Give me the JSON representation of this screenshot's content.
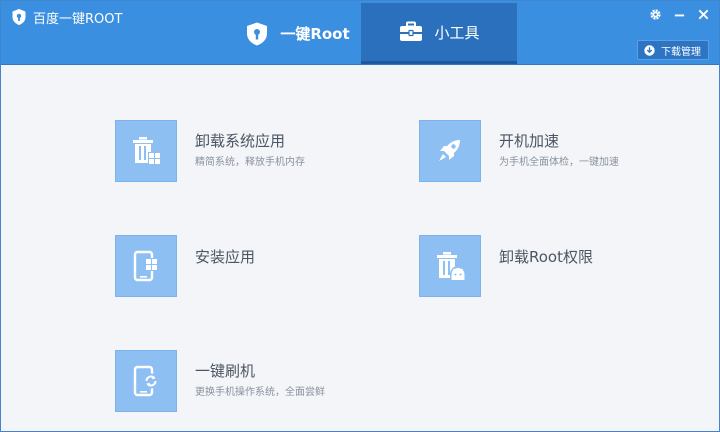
{
  "window": {
    "title": "百度一键ROOT",
    "controls": [
      "gear-icon",
      "minimize-icon",
      "close-icon"
    ]
  },
  "tabs": [
    {
      "label": "一键Root",
      "icon": "shield-icon",
      "active": false
    },
    {
      "label": "小工具",
      "icon": "toolbox-icon",
      "active": true
    }
  ],
  "download_manager": {
    "label": "下载管理",
    "icon": "download-icon"
  },
  "tools": [
    {
      "title": "卸载系统应用",
      "desc": "精简系统，释放手机内存",
      "icon": "trash-apps-icon"
    },
    {
      "title": "开机加速",
      "desc": "为手机全面体检，一键加速",
      "icon": "rocket-icon"
    },
    {
      "title": "安装应用",
      "desc": "",
      "icon": "phone-apps-icon"
    },
    {
      "title": "卸载Root权限",
      "desc": "",
      "icon": "trash-android-icon"
    },
    {
      "title": "一键刷机",
      "desc": "更换手机操作系统，全面尝鲜",
      "icon": "phone-flash-icon"
    }
  ],
  "colors": {
    "header": "#3b8fe0",
    "active_tab": "#2b70bd",
    "tile": "#8dbff3",
    "background": "#f3f5f8",
    "title_text": "#4c5563",
    "desc_text": "#8a929e"
  }
}
